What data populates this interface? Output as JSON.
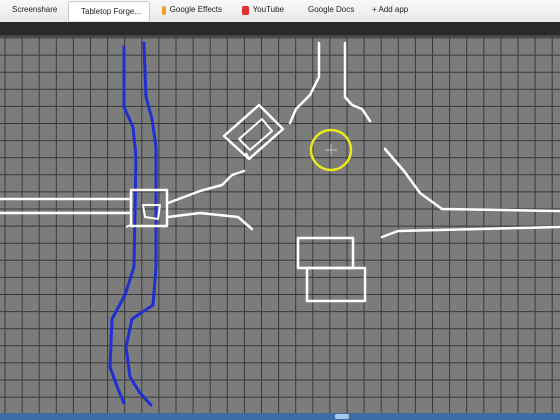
{
  "tabs": [
    {
      "label": "Screenshare",
      "icon": "none",
      "active": false
    },
    {
      "label": "Tabletop Forge...",
      "icon": "tabletop-forge-icon",
      "active": true
    },
    {
      "label": "Google Effects",
      "icon": "google-effects-icon",
      "active": false
    },
    {
      "label": "YouTube",
      "icon": "youtube-icon",
      "active": false
    },
    {
      "label": "Google Docs",
      "icon": "google-docs-icon",
      "active": false
    },
    {
      "label": "+ Add app",
      "icon": "none",
      "active": false
    }
  ],
  "colors": {
    "board_bg": "#7c7c7c",
    "grid_line": "#3a3a3a",
    "road_line": "#ffffff",
    "river_line": "#1f2fd0",
    "cursor_ring": "#e8e81a",
    "toolbar": "#2a2a2a"
  }
}
